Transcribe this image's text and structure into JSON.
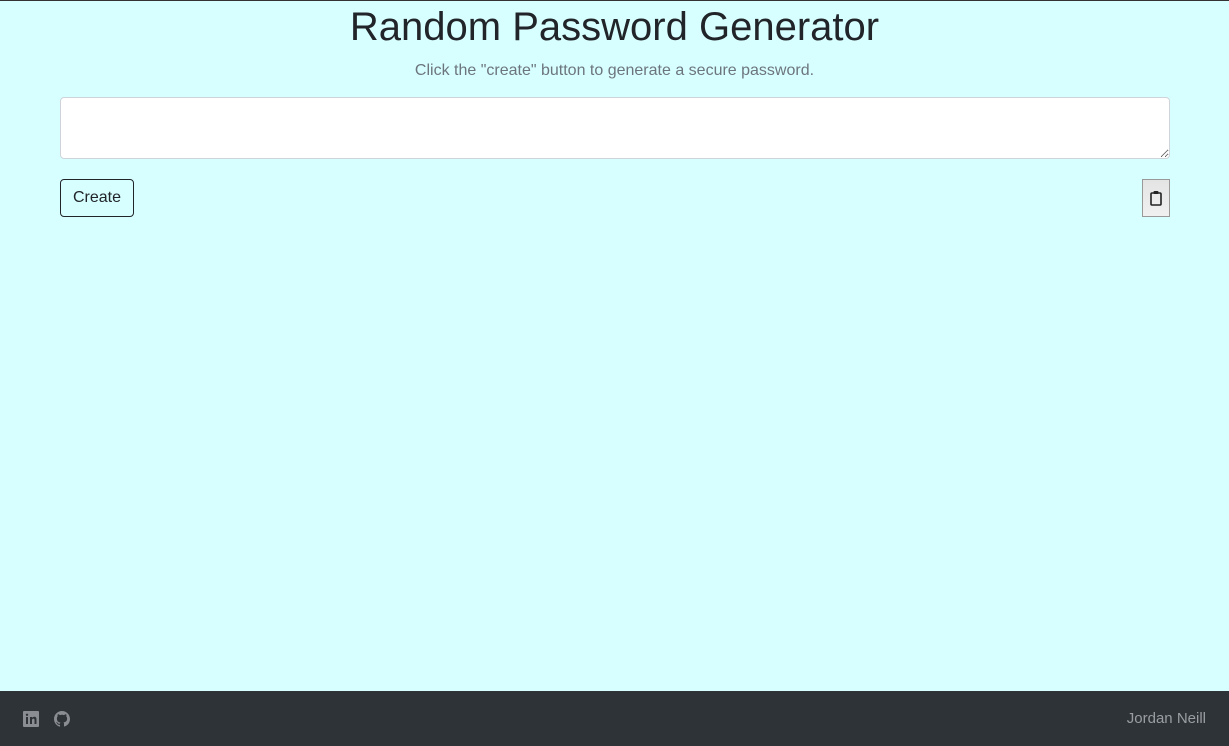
{
  "header": {
    "title": "Random Password Generator",
    "subtitle": "Click the \"create\" button to generate a secure password."
  },
  "password": {
    "value": "",
    "placeholder": ""
  },
  "buttons": {
    "create": "Create",
    "copy_icon": "clipboard-icon"
  },
  "footer": {
    "icons": [
      "linkedin-icon",
      "github-icon"
    ],
    "author": "Jordan Neill"
  }
}
